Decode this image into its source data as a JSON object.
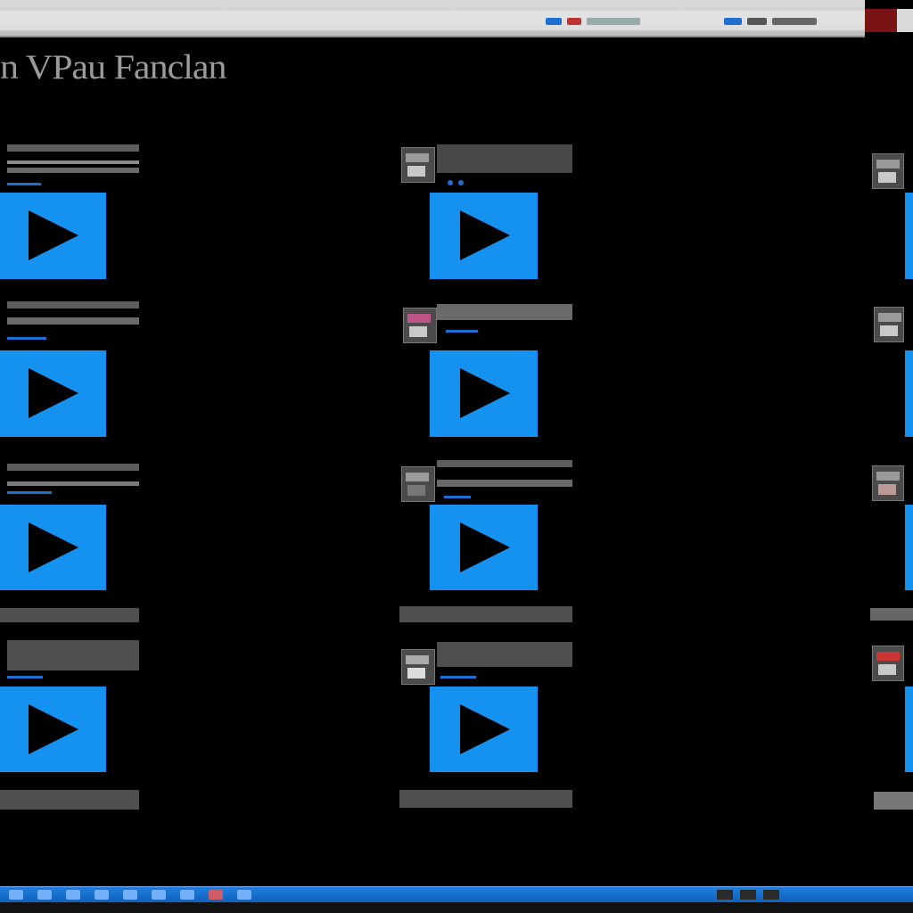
{
  "window": {
    "title": "n VPau Fanclan",
    "accent_color": "#1592f0",
    "background_color": "#000000"
  },
  "topbar": {
    "tray_icons": [
      "window-icon",
      "folder-icon",
      "network-icon",
      "volume-icon",
      "battery-icon",
      "clock-icon"
    ]
  },
  "grid": {
    "columns": 3,
    "rows": 4,
    "items": [
      {
        "row": 1,
        "col": 1,
        "icon": "play-icon"
      },
      {
        "row": 1,
        "col": 2,
        "icon": "play-icon"
      },
      {
        "row": 1,
        "col": 3,
        "icon": "play-icon"
      },
      {
        "row": 2,
        "col": 1,
        "icon": "play-icon"
      },
      {
        "row": 2,
        "col": 2,
        "icon": "play-icon"
      },
      {
        "row": 2,
        "col": 3,
        "icon": "play-icon"
      },
      {
        "row": 3,
        "col": 1,
        "icon": "play-icon"
      },
      {
        "row": 3,
        "col": 2,
        "icon": "play-icon"
      },
      {
        "row": 3,
        "col": 3,
        "icon": "play-icon"
      },
      {
        "row": 4,
        "col": 1,
        "icon": "play-icon"
      },
      {
        "row": 4,
        "col": 2,
        "icon": "play-icon"
      },
      {
        "row": 4,
        "col": 3,
        "icon": "play-icon"
      }
    ]
  },
  "taskbar": {
    "icons": [
      "start-icon",
      "browser-icon",
      "folder-icon",
      "media-icon",
      "mail-icon",
      "app-icon",
      "app-icon",
      "image-icon",
      "settings-icon"
    ],
    "tray_icons": [
      "network-icon",
      "volume-icon",
      "clock-icon"
    ]
  }
}
